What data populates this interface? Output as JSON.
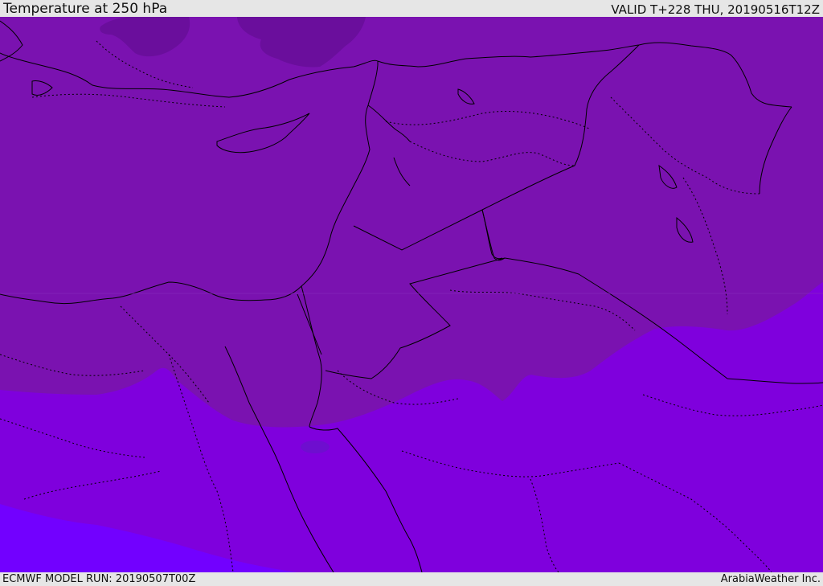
{
  "header": {
    "title": "Temperature at 250 hPa",
    "valid": "VALID T+228 THU, 20190516T12Z"
  },
  "footer": {
    "model_run": "ECMWF MODEL RUN: 20190507T00Z",
    "credit": "ArabiaWeather Inc."
  },
  "map": {
    "field": "temperature-250hPa",
    "region": "eastern-mediterranean-middle-east",
    "colors": {
      "band_darkest": "#6a0e9c",
      "band_main": "#7a12b0",
      "band_lower": "#7f00dd",
      "band_lightest": "#7200ff",
      "coastline": "#000000",
      "borders": "#000000"
    }
  }
}
